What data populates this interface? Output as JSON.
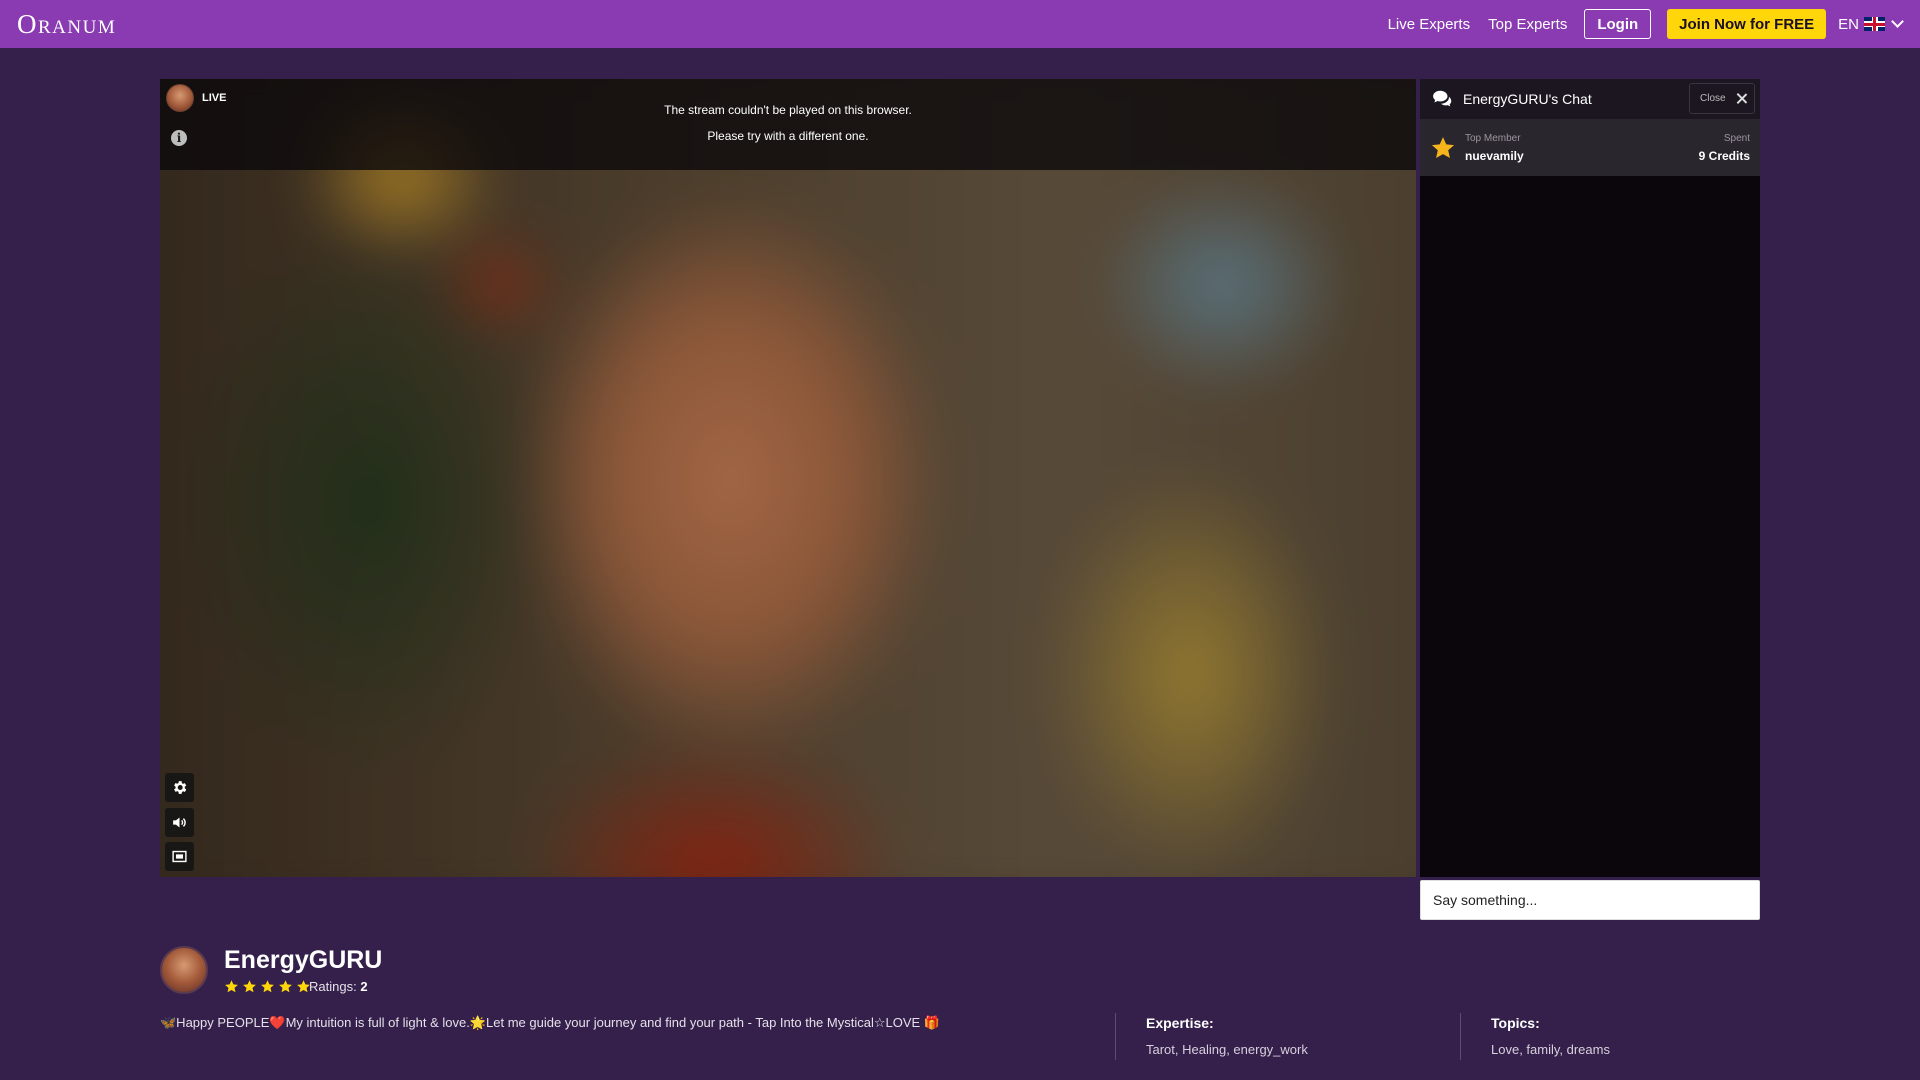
{
  "header": {
    "logo": "Oranum",
    "nav": [
      "Live Experts",
      "Top Experts"
    ],
    "login": "Login",
    "join": "Join Now for FREE",
    "language": "EN",
    "colors": {
      "bar": "#8a3bb2",
      "join_button": "#ffd60a"
    }
  },
  "video": {
    "live_label": "LIVE",
    "message_line1": "The stream couldn't be played on this browser.",
    "message_line2": "Please try with a different one.",
    "controls": [
      "gear-icon",
      "volume-icon",
      "theater-icon"
    ]
  },
  "chat": {
    "title": "EnergyGURU's Chat",
    "close": "Close",
    "top_member_label": "Top Member",
    "top_member_name": "nuevamily",
    "spent_label": "Spent",
    "spent_value": "9 Credits",
    "input_placeholder": "Say something..."
  },
  "profile": {
    "name": "EnergyGURU",
    "stars": 5,
    "ratings_label": "Ratings:",
    "ratings_count": "2",
    "bio": "🦋Happy PEOPLE❤️My intuition is full of light & love.🌟Let me guide your journey and find your path - Tap Into the Mystical☆LOVE 🎁",
    "expertise_title": "Expertise:",
    "expertise": "Tarot, Healing, energy_work",
    "topics_title": "Topics:",
    "topics": "Love, family, dreams"
  }
}
